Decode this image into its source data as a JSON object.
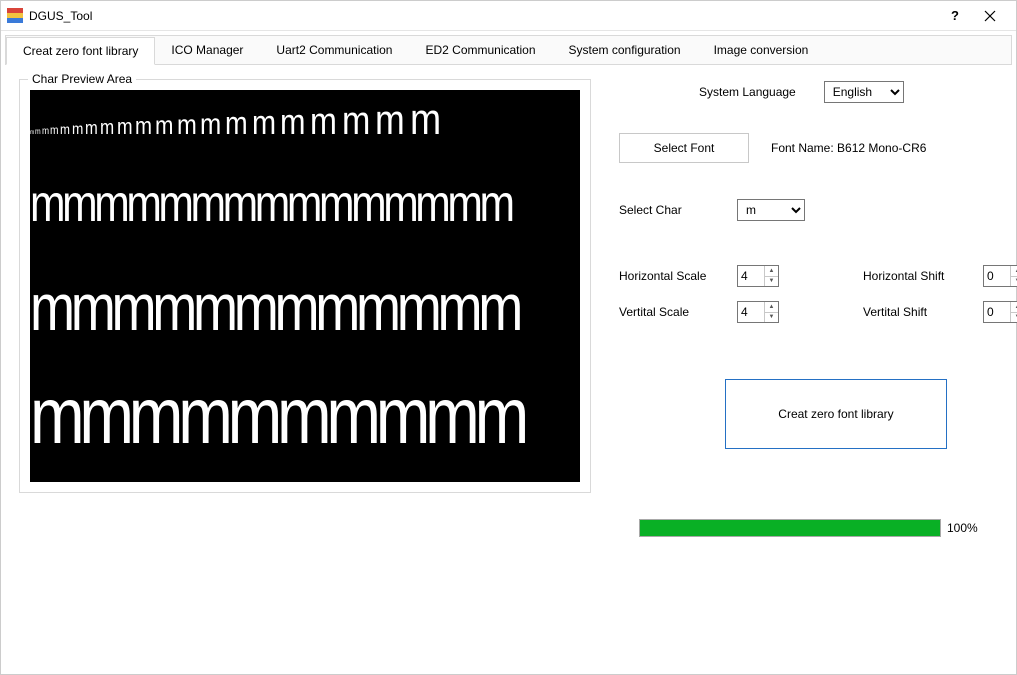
{
  "window": {
    "title": "DGUS_Tool"
  },
  "tabs": [
    "Creat zero font library",
    "ICO Manager",
    "Uart2 Communication",
    "ED2 Communication",
    "System configuration",
    "Image conversion"
  ],
  "active_tab": 0,
  "preview": {
    "group_label": "Char Preview Area",
    "char": "m"
  },
  "controls": {
    "language_label": "System Language",
    "language_value": "English",
    "select_font_btn": "Select Font",
    "font_name_label": "Font Name: B612 Mono-CR6",
    "select_char_label": "Select Char",
    "select_char_value": "m",
    "hscale_label": "Horizontal Scale",
    "hscale_value": "4",
    "vscale_label": "Vertital Scale",
    "vscale_value": "4",
    "hshift_label": "Horizontal Shift",
    "hshift_value": "0",
    "vshift_label": "Vertital Shift",
    "vshift_value": "0",
    "create_btn": "Creat zero font library",
    "progress_percent": 100,
    "progress_text": "100%"
  }
}
